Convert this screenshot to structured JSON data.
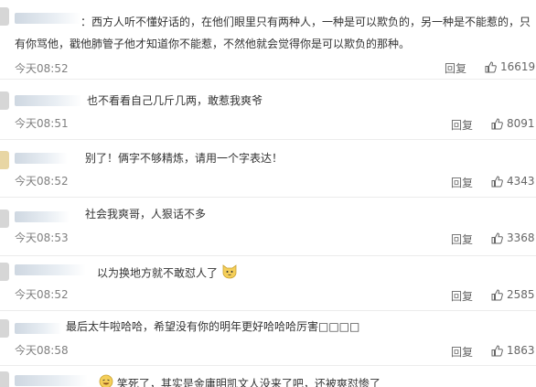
{
  "comments": [
    {
      "lines": [
        "：西方人听不懂好话的，在他们眼里只有两种人，一种是可以欺负的，另一种是不能惹的，只",
        "有你骂他，戳他肺管子他才知道你不能惹，不然他就会觉得你是可以欺负的那种。"
      ],
      "time": "今天08:52",
      "reply": "回复",
      "likes": "16619"
    },
    {
      "lines": [
        "也不看看自己几斤几两，敢惹我爽爷"
      ],
      "time": "今天08:51",
      "reply": "回复",
      "likes": "8091"
    },
    {
      "lines": [
        "别了！俩字不够精炼，请用一个字表达！"
      ],
      "time": "今天08:52",
      "reply": "回复",
      "likes": "4343"
    },
    {
      "lines": [
        "社会我爽哥，人狠话不多"
      ],
      "time": "今天08:53",
      "reply": "回复",
      "likes": "3368"
    },
    {
      "lines": [
        "以为换地方就不敢怼人了"
      ],
      "time": "今天08:52",
      "reply": "回复",
      "likes": "2585",
      "emoji": "cat-face-icon"
    },
    {
      "lines": [
        "最后太牛啦哈哈，希望没有你的明年更好哈哈哈厉害□□□□"
      ],
      "time": "今天08:58",
      "reply": "回复",
      "likes": "1863"
    },
    {
      "lines": [
        "笑死了，其实是金庸明凯文人没来了吧，还被爽怼惨了"
      ],
      "emoji": "laughing-face-icon"
    }
  ],
  "colors": {
    "text": "#333333",
    "muted": "#808080",
    "divider": "#ececec"
  }
}
